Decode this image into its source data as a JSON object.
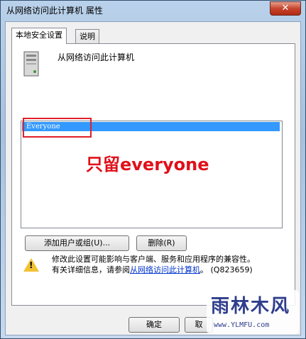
{
  "window": {
    "title": "从网络访问此计算机 属性",
    "close_label": "✕"
  },
  "tabs": [
    {
      "label": "本地安全设置"
    },
    {
      "label": "说明"
    }
  ],
  "policy": {
    "name": "从网络访问此计算机",
    "icon": "server-icon"
  },
  "list": {
    "items": [
      {
        "label": "Everyone",
        "selected": true
      }
    ]
  },
  "annotation": {
    "text": "只留everyone",
    "color": "#e0101a"
  },
  "buttons": {
    "add": "添加用户或组(U)...",
    "remove": "删除(R)",
    "ok": "确定",
    "cancel": "取"
  },
  "warning": {
    "line1": "修改此设置可能影响与客户端、服务和应用程序的兼容性。",
    "line2_prefix": "有关详细信息，请参阅",
    "link": "从网络访问此计算机",
    "kb": "。 (Q823659)"
  },
  "watermark": {
    "title": "雨林木风",
    "url": "www.YLMFU.com"
  }
}
